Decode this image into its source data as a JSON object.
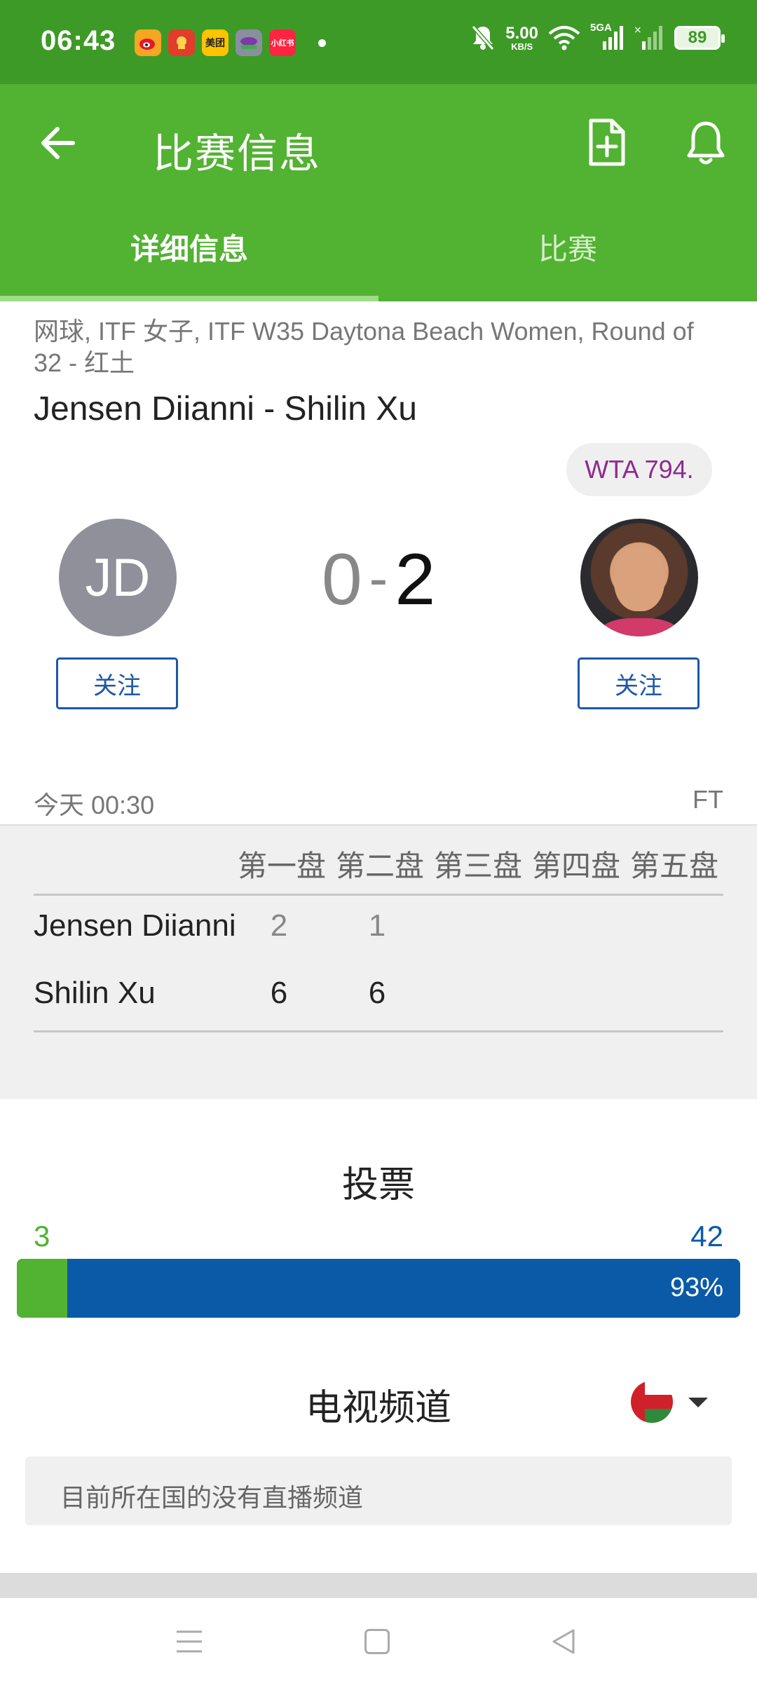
{
  "status_bar": {
    "time": "06:43",
    "app_icons": [
      {
        "name": "weibo-icon",
        "label": "",
        "color": "#f5a623"
      },
      {
        "name": "app-red-icon",
        "label": "",
        "color": "#e23c2c"
      },
      {
        "name": "meituan-icon",
        "label": "美团",
        "color": "#ffc300"
      },
      {
        "name": "app-game-icon",
        "label": "",
        "color": "#8a8fa0"
      },
      {
        "name": "xiaohongshu-icon",
        "label": "小红书",
        "color": "#ff2442"
      }
    ],
    "net_speed": "5.00",
    "net_speed_unit": "KB/S",
    "signal_label": "5GA",
    "battery": "89"
  },
  "app_bar": {
    "title": "比赛信息",
    "tabs": [
      {
        "label": "详细信息",
        "active": true
      },
      {
        "label": "比赛",
        "active": false
      }
    ]
  },
  "match": {
    "meta": "网球, ITF 女子, ITF W35 Daytona Beach Women, Round of 32 - 红土",
    "title": "Jensen Diianni - Shilin Xu",
    "rank_badge": "WTA 794.",
    "home": {
      "initials": "JD",
      "name": "Jensen Diianni",
      "score": "0",
      "follow_label": "关注"
    },
    "away": {
      "name": "Shilin Xu",
      "score": "2",
      "follow_label": "关注"
    },
    "score_dash": "-",
    "time": "今天 00:30",
    "status": "FT"
  },
  "sets": {
    "headers": [
      "第一盘",
      "第二盘",
      "第三盘",
      "第四盘",
      "第五盘"
    ],
    "rows": [
      {
        "name": "Jensen Diianni",
        "set1": "2",
        "set2": "1"
      },
      {
        "name": "Shilin Xu",
        "set1": "6",
        "set2": "6"
      }
    ]
  },
  "vote": {
    "title": "投票",
    "home_votes": "3",
    "away_votes": "42",
    "away_percent_label": "93%",
    "home_fraction": 0.07,
    "home_color": "#52b231",
    "away_color": "#0b5aa8"
  },
  "tv": {
    "title": "电视频道",
    "empty_message": "目前所在国的没有直播频道",
    "country_flag": "oman-flag-icon"
  }
}
